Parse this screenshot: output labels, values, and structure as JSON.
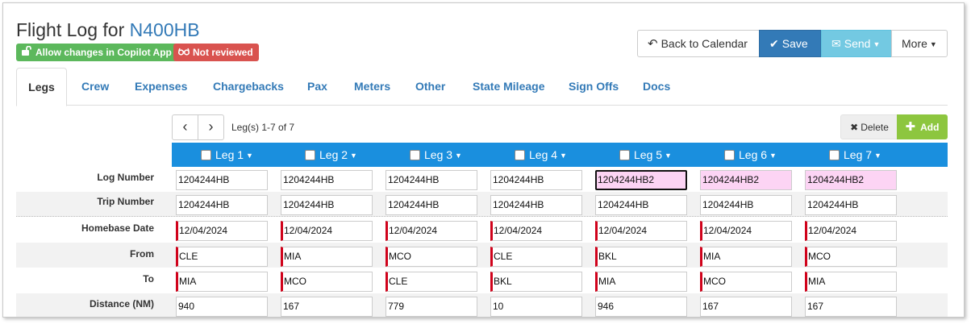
{
  "header": {
    "title_prefix": "Flight Log for ",
    "tail_number": "N400HB",
    "badges": {
      "allow_copilot": "Allow changes in Copilot App",
      "not_reviewed": "Not reviewed"
    }
  },
  "toolbar": {
    "back": "Back to Calendar",
    "save": "Save",
    "send": "Send",
    "more": "More"
  },
  "tabs": [
    "Legs",
    "Crew",
    "Expenses",
    "Chargebacks",
    "Pax",
    "Meters",
    "Other",
    "State Mileage",
    "Sign Offs",
    "Docs"
  ],
  "pager": {
    "count_text": "Leg(s) 1-7 of 7"
  },
  "actions": {
    "delete": "Delete",
    "add": "Add"
  },
  "legs": [
    "Leg 1",
    "Leg 2",
    "Leg 3",
    "Leg 4",
    "Leg 5",
    "Leg 6",
    "Leg 7"
  ],
  "rows": [
    {
      "label": "Log Number",
      "values": [
        "1204244HB",
        "1204244HB",
        "1204244HB",
        "1204244HB",
        "1204244HB2",
        "1204244HB2",
        "1204244HB2"
      ]
    },
    {
      "label": "Trip Number",
      "values": [
        "1204244HB",
        "1204244HB",
        "1204244HB",
        "1204244HB",
        "1204244HB",
        "1204244HB",
        "1204244HB"
      ]
    },
    {
      "label": "Homebase Date",
      "values": [
        "12/04/2024",
        "12/04/2024",
        "12/04/2024",
        "12/04/2024",
        "12/04/2024",
        "12/04/2024",
        "12/04/2024"
      ]
    },
    {
      "label": "From",
      "values": [
        "CLE",
        "MIA",
        "MCO",
        "CLE",
        "BKL",
        "MIA",
        "MCO"
      ]
    },
    {
      "label": "To",
      "values": [
        "MIA",
        "MCO",
        "CLE",
        "BKL",
        "MIA",
        "MCO",
        "MIA"
      ]
    },
    {
      "label": "Distance (NM)",
      "values": [
        "940",
        "167",
        "779",
        "10",
        "946",
        "167",
        "167"
      ]
    }
  ],
  "colors": {
    "primary": "#337ab7",
    "leg_header": "#1a8fde",
    "add": "#8dc63f",
    "required": "#d0021b",
    "highlight": "#fcd4f4"
  }
}
